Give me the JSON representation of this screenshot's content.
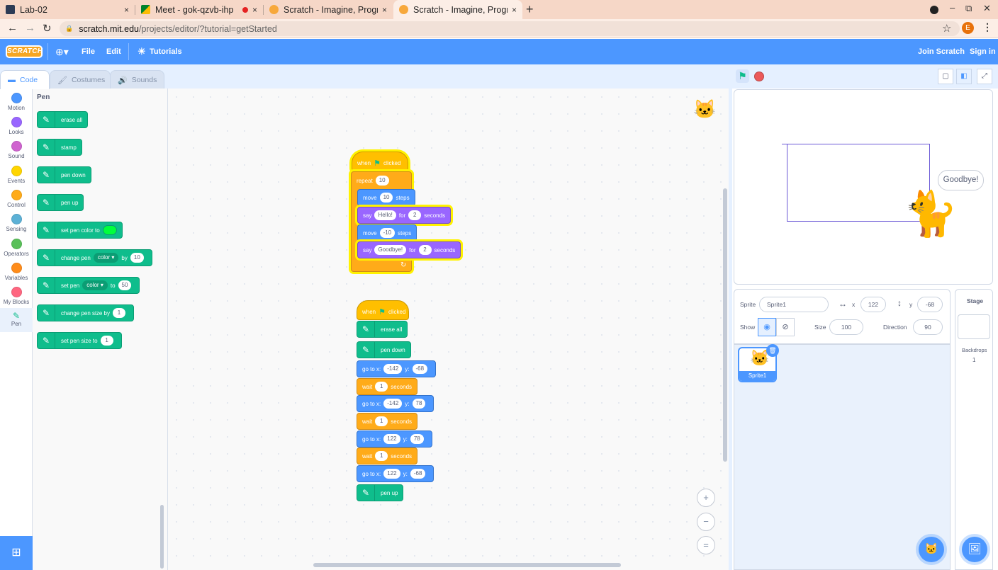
{
  "browser": {
    "tabs": [
      {
        "title": "Lab-02",
        "close": "×"
      },
      {
        "title": "Meet - gok-qzvb-ihp",
        "close": "×"
      },
      {
        "title": "Scratch - Imagine, Program, Share",
        "close": "×"
      },
      {
        "title": "Scratch - Imagine, Program, Share",
        "close": "×"
      }
    ],
    "new_tab": "+",
    "url_host": "scratch.mit.edu",
    "url_path": "/projects/editor/?tutorial=getStarted",
    "profile_initial": "E"
  },
  "menu": {
    "logo": "SCRATCH",
    "file": "File",
    "edit": "Edit",
    "tutorials": "Tutorials",
    "join": "Join Scratch",
    "signin": "Sign in"
  },
  "editor_tabs": {
    "code": "Code",
    "costumes": "Costumes",
    "sounds": "Sounds"
  },
  "categories": [
    {
      "label": "Motion",
      "color": "#4c97ff"
    },
    {
      "label": "Looks",
      "color": "#9966ff"
    },
    {
      "label": "Sound",
      "color": "#cf63cf"
    },
    {
      "label": "Events",
      "color": "#ffd500"
    },
    {
      "label": "Control",
      "color": "#ffab19"
    },
    {
      "label": "Sensing",
      "color": "#5cb1d6"
    },
    {
      "label": "Operators",
      "color": "#59c059"
    },
    {
      "label": "Variables",
      "color": "#ff8c1a"
    },
    {
      "label": "My Blocks",
      "color": "#ff6680"
    },
    {
      "label": "Pen",
      "color": "#0fbd8c"
    }
  ],
  "palette": {
    "title": "Pen",
    "erase_all": "erase all",
    "stamp": "stamp",
    "pen_down": "pen down",
    "pen_up": "pen up",
    "set_pen_color_to": "set pen color to",
    "change_pen": "change pen",
    "color_opt": "color",
    "by": "by",
    "change_by_val": "10",
    "set_pen": "set pen",
    "to": "to",
    "set_to_val": "50",
    "change_pen_size_by": "change pen size by",
    "size_by_val": "1",
    "set_pen_size_to": "set pen size to",
    "size_to_val": "1"
  },
  "script1": {
    "when": "when",
    "clicked": "clicked",
    "repeat": "repeat",
    "repeat_count": "10",
    "move": "move",
    "steps": "steps",
    "move1": "10",
    "say": "say",
    "for": "for",
    "seconds": "seconds",
    "say1_text": "Hello!",
    "say1_secs": "2",
    "move2": "-10",
    "say2_text": "Goodbye!",
    "say2_secs": "2"
  },
  "script2": {
    "when": "when",
    "clicked": "clicked",
    "erase_all": "erase all",
    "pen_down": "pen down",
    "goto": "go to x:",
    "y": "y:",
    "wait": "wait",
    "seconds": "seconds",
    "g1x": "-142",
    "g1y": "-68",
    "w1": "1",
    "g2x": "-142",
    "g2y": "78",
    "w2": "1",
    "g3x": "122",
    "g3y": "78",
    "w3": "1",
    "g4x": "122",
    "g4y": "-68",
    "pen_up": "pen up"
  },
  "zoom": {
    "in": "+",
    "out": "−",
    "reset": "="
  },
  "stage": {
    "bubble": "Goodbye!"
  },
  "sprite_info": {
    "sprite_label": "Sprite",
    "sprite_name": "Sprite1",
    "x_label": "x",
    "x_value": "122",
    "y_label": "y",
    "y_value": "-68",
    "show_label": "Show",
    "size_label": "Size",
    "size_value": "100",
    "direction_label": "Direction",
    "direction_value": "90"
  },
  "sprites": [
    {
      "name": "Sprite1"
    }
  ],
  "stage_pane": {
    "title": "Stage",
    "backdrops_label": "Backdrops",
    "backdrops_count": "1"
  }
}
